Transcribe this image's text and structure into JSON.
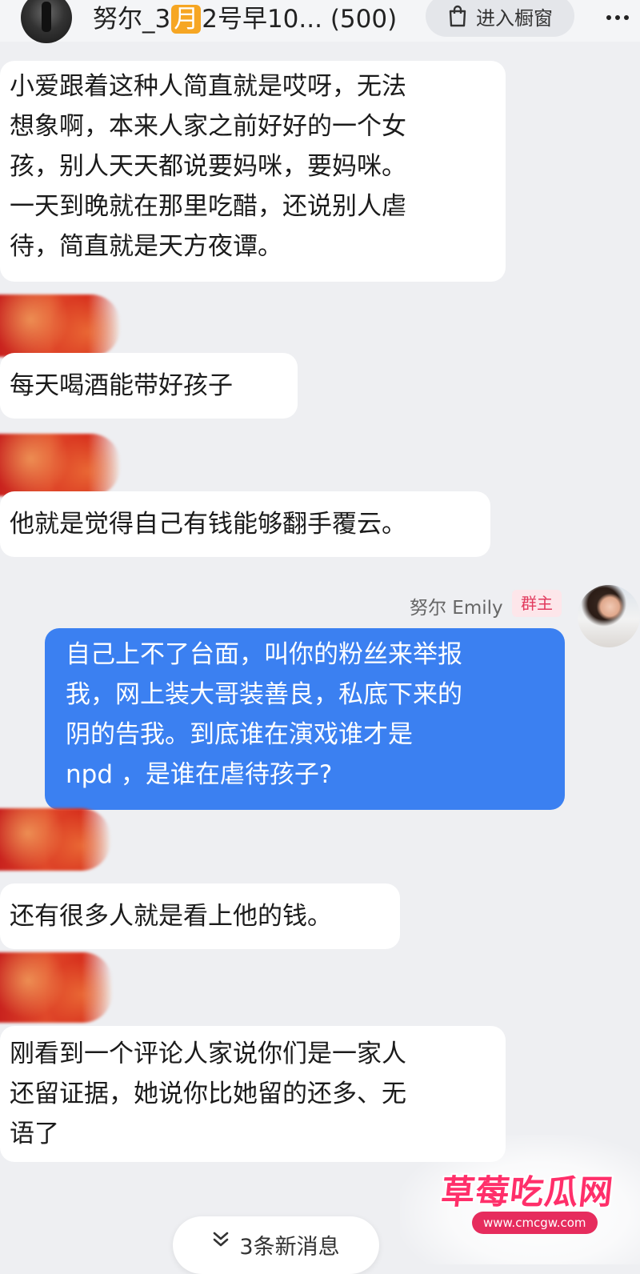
{
  "header": {
    "title_prefix": "努尔_3",
    "title_badge": "月",
    "title_suffix": "2号早10... (500)",
    "shop_label": "进入橱窗",
    "shop_icon": "shopping-bag-icon",
    "more_icon": "more-dots-icon"
  },
  "messages": [
    {
      "lines": [
        "小爱跟着这种人简直就是哎呀，无法",
        "想象啊，本来人家之前好好的一个女",
        "孩，别人天天都说要妈咪，要妈咪。",
        "一天到晚就在那里吃醋，还说别人虐",
        "待，简直就是天方夜谭。"
      ]
    },
    {
      "lines": [
        "每天喝酒能带好孩子"
      ]
    },
    {
      "lines": [
        "他就是觉得自己有钱能够翻手覆云。"
      ]
    },
    {
      "sender": "努尔 Emily",
      "role": "群主",
      "lines": [
        "自己上不了台面，叫你的粉丝来举报",
        "我，网上装大哥装善良，私底下来的",
        "阴的告我。到底谁在演戏谁才是",
        "npd ，是谁在虐待孩子?"
      ]
    },
    {
      "lines": [
        "还有很多人就是看上他的钱。"
      ]
    },
    {
      "lines": [
        "刚看到一个评论人家说你们是一家人",
        "还留证据，她说你比她留的还多、无",
        "语了"
      ]
    }
  ],
  "new_messages_label": "3条新消息",
  "watermark": {
    "title": "草莓吃瓜网",
    "url": "www.cmcgw.com"
  },
  "colors": {
    "self_bubble": "#3b80f1",
    "background": "#eeeff2",
    "role_badge": "#e23b5e"
  }
}
